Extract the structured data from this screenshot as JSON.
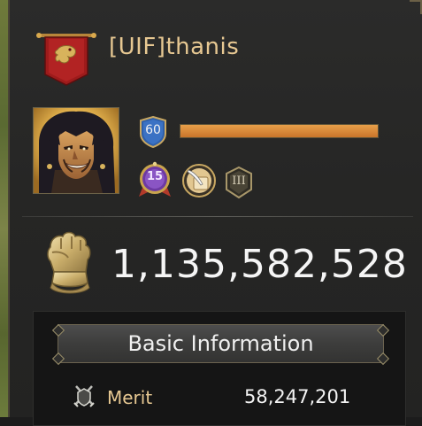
{
  "profile": {
    "name": "[UIF]thanis",
    "level": "60",
    "xp_progress": 1.0,
    "vip_level": "15",
    "rank_numeral": "III",
    "power": "1,135,582,528"
  },
  "basic_info": {
    "header": "Basic Information",
    "rows": [
      {
        "label": "Merit",
        "value": "58,247,201",
        "icon": "merit-crossed-swords-icon"
      }
    ]
  },
  "colors": {
    "name_gold": "#e7c892",
    "xp_orange": "#d98a38",
    "banner_red": "#9e1b1b",
    "level_blue": "#2f5fa8",
    "vip_purple": "#6d3aa3"
  },
  "icons": {
    "banner": "alliance-dragon-banner-icon",
    "portrait": "commander-portrait",
    "level": "shield-level-badge-icon",
    "vip": "vip-badge-icon",
    "quill": "quill-scroll-badge-icon",
    "rank": "rank-badge-icon",
    "power": "gauntlet-fist-icon",
    "merit": "merit-crossed-swords-icon"
  }
}
